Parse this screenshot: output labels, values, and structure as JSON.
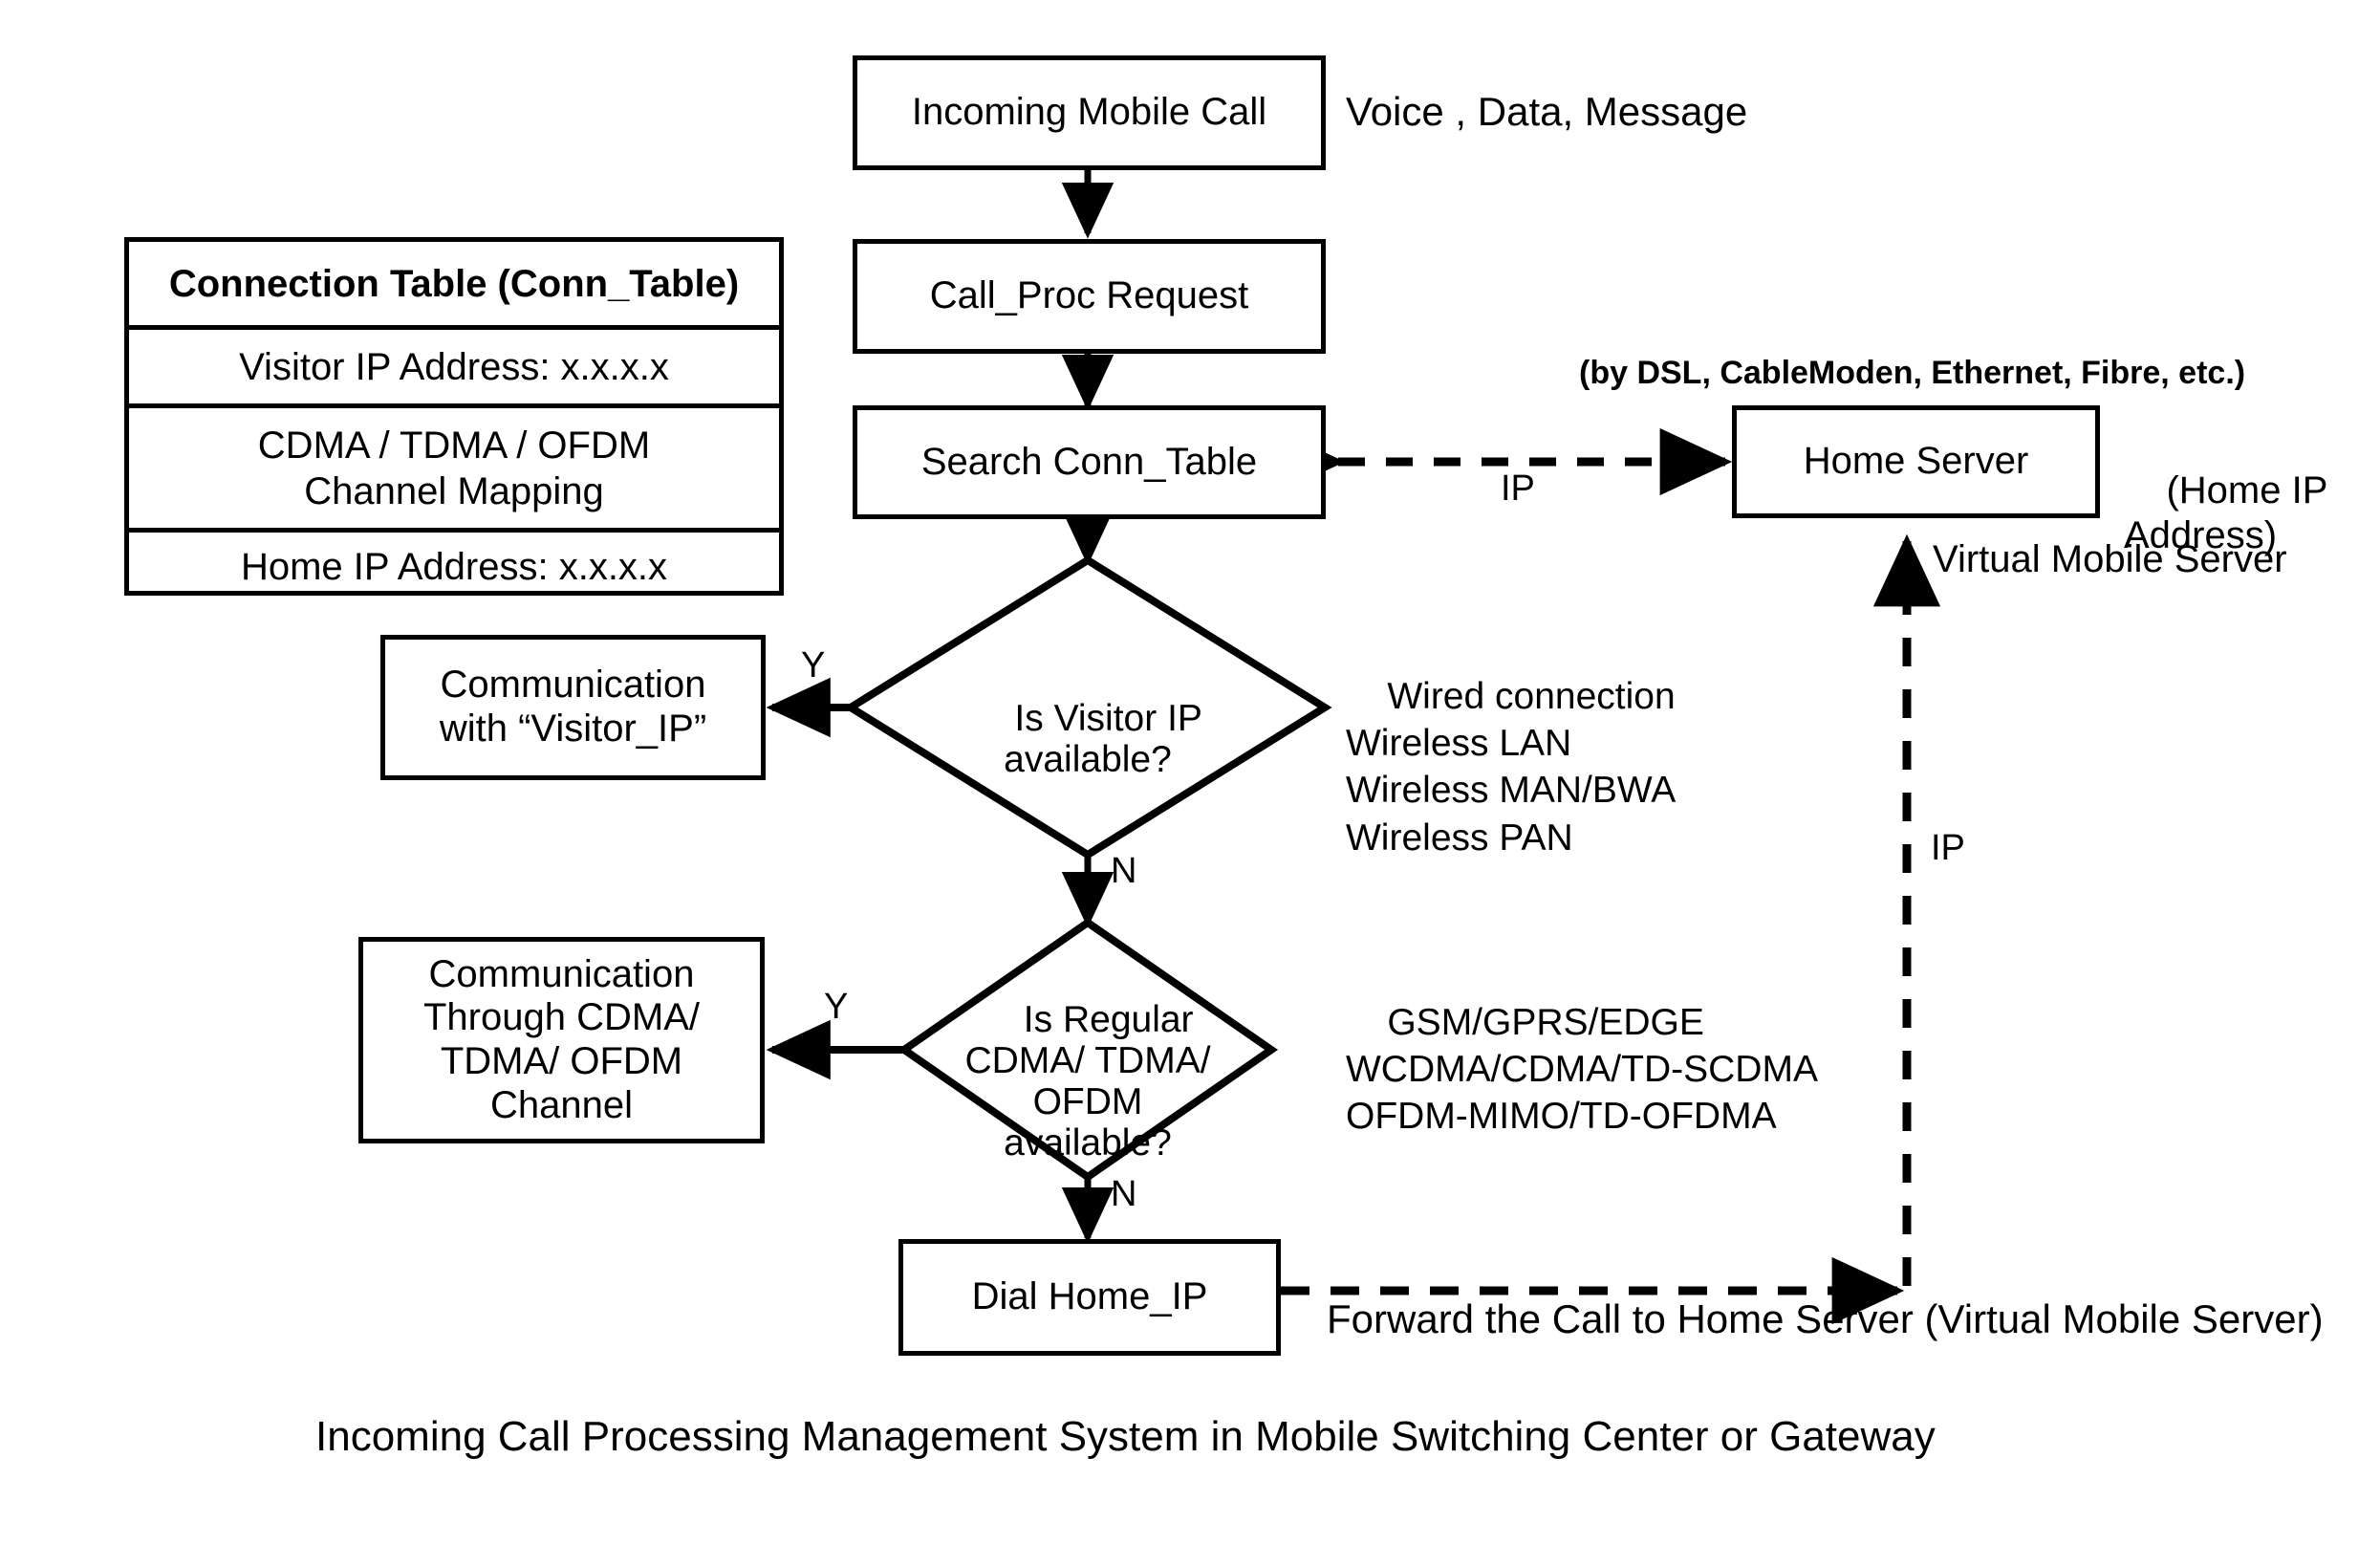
{
  "figure": {
    "caption": "Incoming Call Processing Management System in Mobile Switching Center or Gateway"
  },
  "conn_table": {
    "header": "Connection Table (Conn_Table)",
    "rows": [
      "Visitor IP Address: x.x.x.x",
      "CDMA / TDMA / OFDM\nChannel  Mapping",
      "Home IP Address: x.x.x.x"
    ]
  },
  "nodes": {
    "incoming_mobile_call": "Incoming Mobile Call",
    "call_proc_request": "Call_Proc Request",
    "search_conn_table": "Search Conn_Table",
    "home_server": "Home Server",
    "decision_visitor_ip": "Is Visitor IP\navailable?",
    "decision_regular_channel": "Is Regular\nCDMA/ TDMA/\nOFDM\navailable?",
    "comm_visitor_ip": "Communication\nwith “Visitor_IP”",
    "comm_cdma_channel": "Communication\nThrough CDMA/\nTDMA/ OFDM\nChannel",
    "dial_home_ip": "Dial Home_IP"
  },
  "annotations": {
    "call_types": "Voice , Data, Message",
    "home_server_transport": "(by DSL, CableModen, Ethernet, Fibre, etc.)",
    "home_ip_address": "(Home IP\nAddress)",
    "virtual_mobile_server": "Virtual Mobile Server",
    "visitor_ip_methods": "Wired  connection\nWireless LAN\nWireless MAN/BWA\nWireless PAN",
    "channel_methods": "GSM/GPRS/EDGE\nWCDMA/CDMA/TD-SCDMA\nOFDM-MIMO/TD-OFDMA",
    "forward_call": "Forward the Call to Home Server (Virtual Mobile Server)"
  },
  "edge_labels": {
    "ip_horizontal": "IP",
    "ip_vertical": "IP",
    "yes_visitor": "Y",
    "no_visitor": "N",
    "yes_channel": "Y",
    "no_channel": "N"
  },
  "colors": {
    "stroke": "#000000",
    "background": "#ffffff"
  }
}
